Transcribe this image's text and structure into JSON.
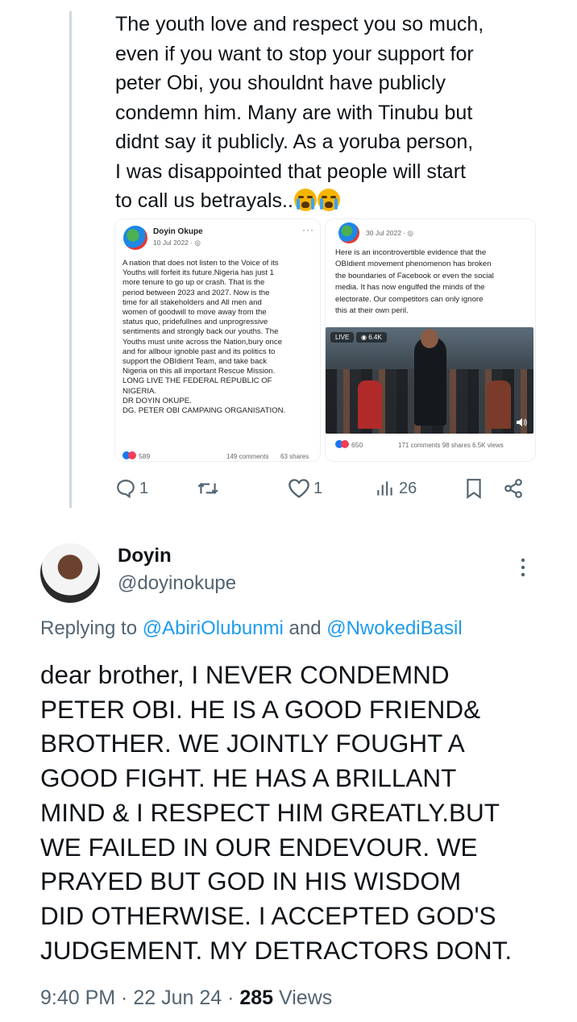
{
  "quoted_tweet": {
    "text_lines": [
      "The youth love and respect you so much,",
      "even if you want to stop your support for",
      "peter Obi,  you shouldnt have publicly",
      "condemn him. Many are with Tinubu but",
      "didnt say it publicly. As a yoruba person,",
      "I was disappointed that people will start",
      "to call us betrayals.."
    ],
    "emoji": "loudly-crying-face-emoji",
    "left_card": {
      "name": "Doyin Okupe",
      "date": "10 Jul 2022 · ",
      "body": "A nation that does not listen to the Voice of its\nYouths will forfeit its future.Nigeria has just 1\nmore tenure to go up or crash. That is the\nperiod between 2023 and 2027. Now is the\ntime for all stakeholders and All men and\nwomen of goodwill to move away from the\nstatus quo, pridefullnes and unprogressive\nsentiments and strongly back our youths. The\nYouths must unite across the Nation,bury once\nand for allbour ignoble past and its politics to\nsupport the OBIdient Team, and take back\nNigeria on this all important Rescue Mission.\nLONG LIVE THE FEDERAL REPUBLIC OF\nNIGERIA.\nDR DOYIN OKUPE.\nDG. PETER OBI CAMPAING ORGANISATION.",
      "reactions": "589",
      "comments": "149 comments",
      "shares": "63 shares"
    },
    "right_card": {
      "date": "30 Jul 2022 · ",
      "body": "Here is an incontrovertible evidence that the\nOBIdient movement phenomenon has broken\nthe boundaries of Facebook or even the social\nmedia. It has now engulfed the minds of the\nelectorate. Our competitors can only ignore\nthis at their own peril.",
      "live_label": "LIVE",
      "video_views": "6.4K",
      "reactions": "650",
      "stats": "171 comments  98 shares  6.5K views"
    },
    "actions": {
      "replies": "1",
      "likes": "1",
      "views": "26"
    }
  },
  "reply_tweet": {
    "author_name": "Doyin",
    "author_handle": "@doyinokupe",
    "replying_prefix": "Replying to ",
    "replying_user_1": "@AbiriOlubunmi",
    "replying_and": " and ",
    "replying_user_2": "@NwokediBasil",
    "text": "dear brother, I NEVER  CONDEMND\nPETER OBI. HE IS A GOOD FRIEND&\nBROTHER. WE JOINTLY FOUGHT A\nGOOD FIGHT. HE HAS A BRILLANT\nMIND & I RESPECT HIM GREATLY.BUT\nWE FAILED IN OUR ENDEVOUR. WE\nPRAYED BUT GOD IN HIS WISDOM\nDID OTHERWISE. I ACCEPTED GOD'S\nJUDGEMENT. MY DETRACTORS DONT.",
    "time": "9:40 PM · 22 Jun 24 · ",
    "views_count": "285",
    "views_label": " Views"
  },
  "colors": {
    "text": "#0f1419",
    "secondary": "#536471",
    "link": "#1d9bf0",
    "thread_line": "#cfd9de"
  }
}
